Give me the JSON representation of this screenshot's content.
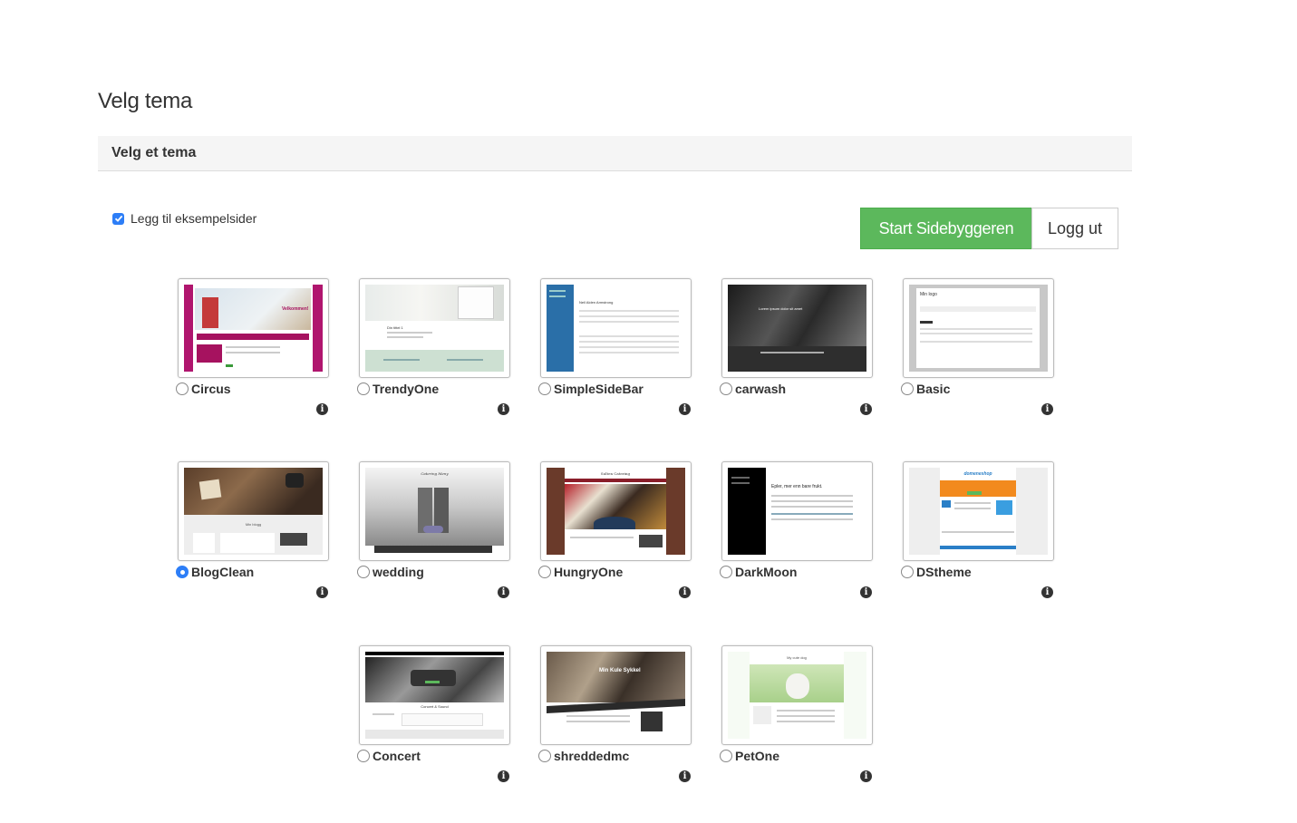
{
  "page": {
    "title": "Velg tema",
    "section_heading": "Velg et tema"
  },
  "options": {
    "sample_pages_label": "Legg til eksempelsider",
    "sample_pages_checked": true
  },
  "buttons": {
    "start_label": "Start Sidebyggeren",
    "logout_label": "Logg ut",
    "start_color": "#5cb85c"
  },
  "info_glyph": "i",
  "themes": [
    {
      "name": "Circus",
      "selected": false,
      "preview_text": "Velkommen!"
    },
    {
      "name": "TrendyOne",
      "selected": false,
      "preview_text": "Din tittel 1"
    },
    {
      "name": "SimpleSideBar",
      "selected": false,
      "preview_text": "Neil Alden Armstrong"
    },
    {
      "name": "carwash",
      "selected": false,
      "preview_text": "Lorem ipsum dolor sit amet"
    },
    {
      "name": "Basic",
      "selected": false,
      "preview_text": "Min logo"
    },
    {
      "name": "BlogClean",
      "selected": true,
      "preview_text": "Min blogg"
    },
    {
      "name": "wedding",
      "selected": false,
      "preview_text": "Catering Meny"
    },
    {
      "name": "HungryOne",
      "selected": false,
      "preview_text": "Sulten Catering"
    },
    {
      "name": "DarkMoon",
      "selected": false,
      "preview_text": "Epler, mer enn bare frukt."
    },
    {
      "name": "DStheme",
      "selected": false,
      "preview_text": "domeneshop"
    },
    {
      "name": "Concert",
      "selected": false,
      "preview_text": "Concert & Sound"
    },
    {
      "name": "shreddedmc",
      "selected": false,
      "preview_text": "Min Kule Sykkel"
    },
    {
      "name": "PetOne",
      "selected": false,
      "preview_text": "My cute dog"
    }
  ]
}
